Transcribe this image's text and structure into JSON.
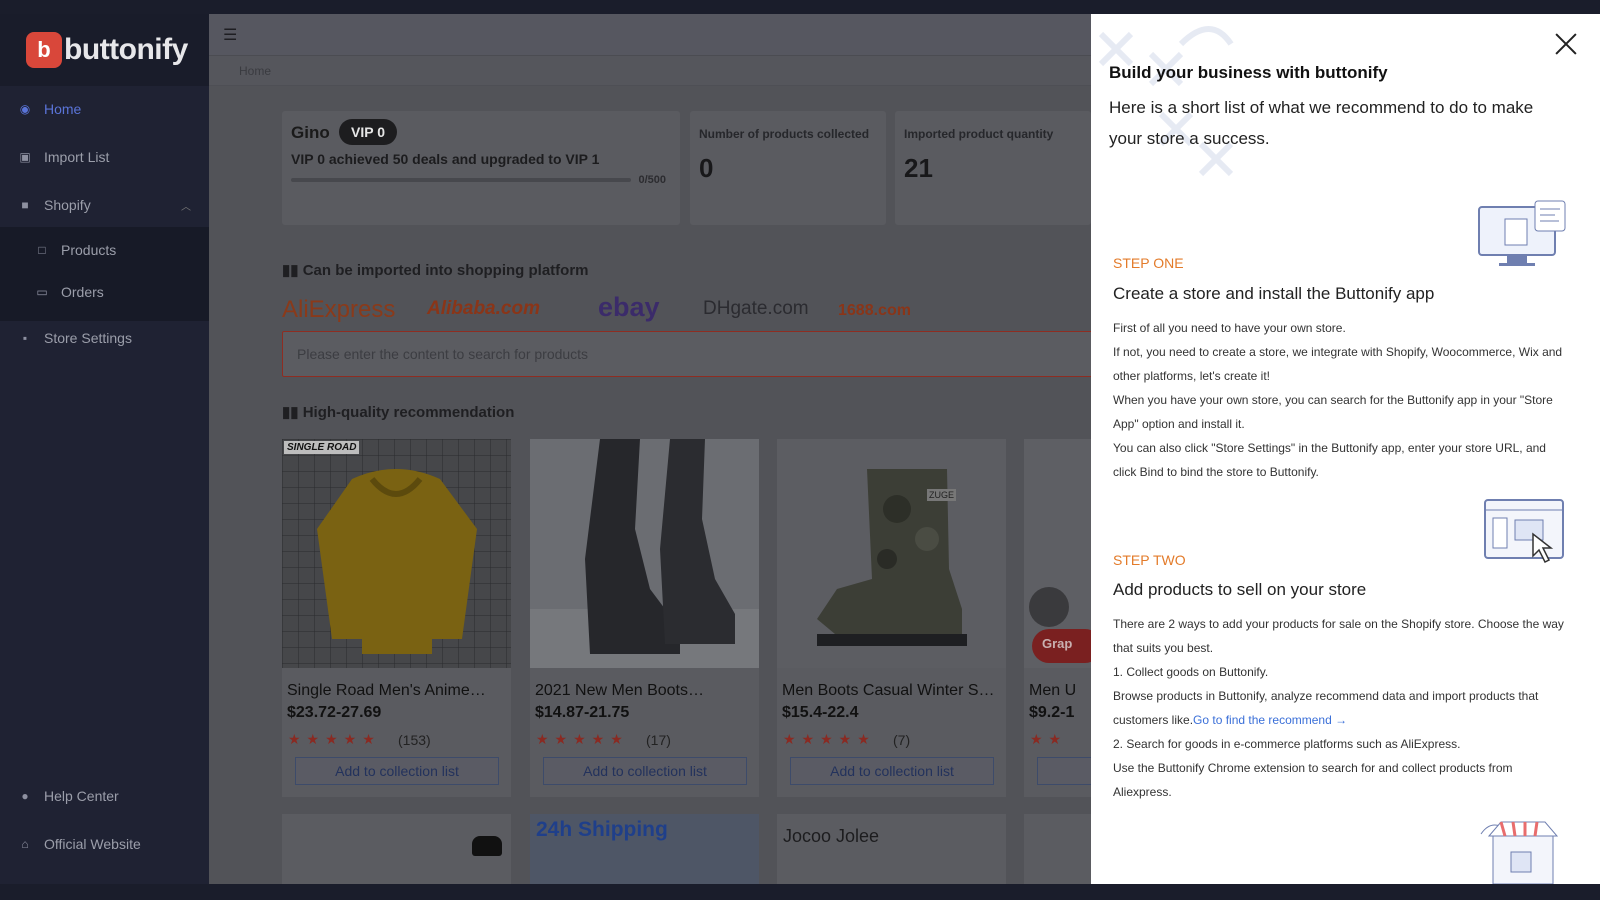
{
  "brand": {
    "name": "buttonify",
    "icon": "b"
  },
  "sidebar": {
    "items": [
      {
        "label": "Home",
        "icon": "dashboard-icon",
        "active": true
      },
      {
        "label": "Import List",
        "icon": "clipboard-icon"
      },
      {
        "label": "Shopify",
        "icon": "bag-icon"
      },
      {
        "label": "Products",
        "icon": "bag-outline-icon"
      },
      {
        "label": "Orders",
        "icon": "archive-icon"
      },
      {
        "label": "Store Settings",
        "icon": "store-icon"
      },
      {
        "label": "Help Center",
        "icon": "help-icon"
      },
      {
        "label": "Official Website",
        "icon": "home-icon"
      }
    ]
  },
  "breadcrumb": "Home",
  "user": {
    "name": "Gino",
    "vip": "VIP 0",
    "note": "VIP 0 achieved 50 deals and upgraded to VIP 1",
    "progress_label": "0/500",
    "progress_fraction": 0
  },
  "stats": [
    {
      "title": "Number of products collected",
      "value": "0"
    },
    {
      "title": "Imported product quantity",
      "value": "21"
    }
  ],
  "platforms": {
    "title": "Can be imported into shopping platform",
    "brands": [
      "AliExpress",
      "Alibaba.com",
      "ebay",
      "DHgate.com",
      "1688.com"
    ]
  },
  "search": {
    "placeholder": "Please enter the content to search for products"
  },
  "recommend": {
    "title": "High-quality recommendation",
    "button_label": "Add to collection list",
    "products": [
      {
        "name": "Single Road Men's Anime…",
        "price": "$23.72-27.69",
        "count": "(153)",
        "tag": "SINGLE ROAD"
      },
      {
        "name": "2021 New Men Boots…",
        "price": "$14.87-21.75",
        "count": "(17)"
      },
      {
        "name": "Men Boots Casual Winter Sn…",
        "price": "$15.4-22.4",
        "count": "(7)",
        "tag": "ZUGE"
      },
      {
        "name": "Men U",
        "price": "$9.2-1",
        "tag": "Grap"
      }
    ],
    "bottom_cards": [
      "",
      "24h Shipping",
      "Jocoo Jolee",
      ""
    ]
  },
  "panel": {
    "title": "Build your business with buttonify",
    "intro": "Here is a short list of what we recommend to do to make your store a success.",
    "step1": {
      "label": "STEP ONE",
      "title": "Create a store and install the Buttonify app",
      "lines": [
        "First of all you need to have your own store.",
        "If not, you need to create a store, we integrate with Shopify, Woocommerce, Wix and other platforms, let's create it!",
        "When you have your own store, you can search for the Buttonify app in your \"Store App\" option and install it.",
        "You can also click \"Store Settings\" in the Buttonify app, enter your store URL, and click Bind to bind the store to Buttonify."
      ]
    },
    "step2": {
      "label": "STEP TWO",
      "title": "Add products to sell on your store",
      "line1": "There are 2 ways to add your products for sale on the Shopify store. Choose the way that suits you best.",
      "line2": "1. Collect goods on Buttonify.",
      "line3": "Browse products in Buttonify, analyze recommend data and import products that customers like.",
      "link": "Go to find the recommend →",
      "line4": "2. Search for goods in e-commerce platforms such as AliExpress.",
      "line5": "Use the Buttonify Chrome extension to search for and collect products from Aliexpress."
    }
  },
  "colors": {
    "accent": "#e37b2a",
    "link": "#3a6fd8",
    "active_nav": "#5a74d8",
    "sidebar": "#1f2233"
  }
}
